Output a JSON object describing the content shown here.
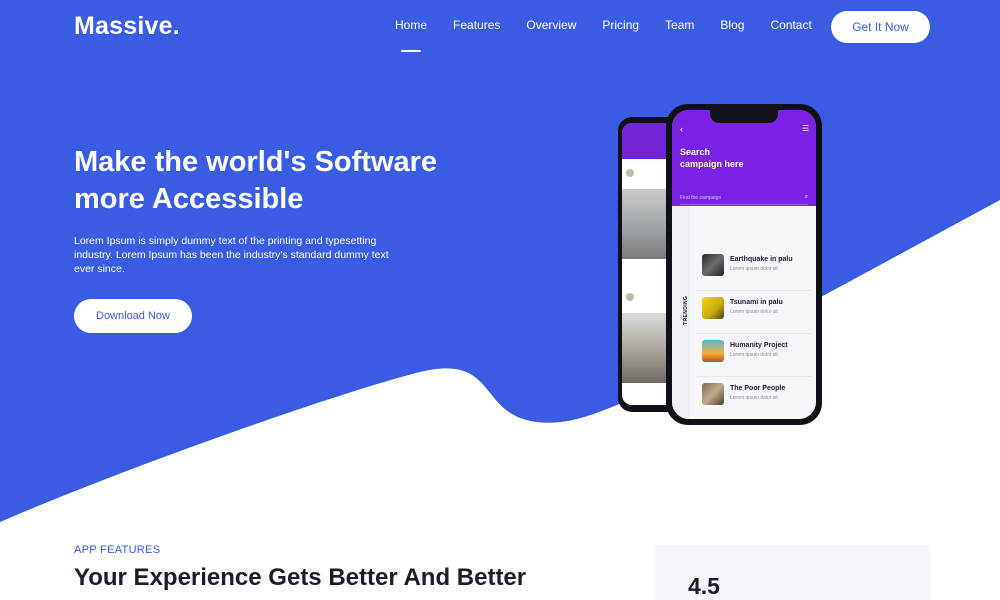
{
  "brand": {
    "logo_text": "Massive."
  },
  "nav": {
    "items": [
      {
        "label": "Home",
        "active": true
      },
      {
        "label": "Features"
      },
      {
        "label": "Overview"
      },
      {
        "label": "Pricing"
      },
      {
        "label": "Team"
      },
      {
        "label": "Blog"
      },
      {
        "label": "Contact"
      }
    ],
    "cta_label": "Get It Now"
  },
  "hero": {
    "title_line1": "Make the world's Software",
    "title_line2": "more Accessible",
    "description": "Lorem Ipsum is simply dummy text of the printing and typesetting industry. Lorem Ipsum has been the industry's standard dummy text ever since.",
    "button_label": "Download Now"
  },
  "phone": {
    "screen_title_line1": "Search",
    "screen_title_line2": "campaign here",
    "search_placeholder": "Find the campaign",
    "side_label": "TRENDING",
    "campaigns": [
      {
        "title": "Earthquake in palu",
        "subtitle": "Lorem ipsum dolor sit"
      },
      {
        "title": "Tsunami in palu",
        "subtitle": "Lorem ipsum dolor sit"
      },
      {
        "title": "Humanity Project",
        "subtitle": "Lorem ipsum dolor sit"
      },
      {
        "title": "The Poor People",
        "subtitle": "Lorem ipsum dolor sit"
      }
    ]
  },
  "features": {
    "label": "APP FEATURES",
    "title": "Your Experience Gets Better And Better",
    "rating_value": "4.5"
  },
  "colors": {
    "primary": "#3a5ce3",
    "phone_header": "#7a22e4",
    "text_dark": "#1b1d2e"
  }
}
